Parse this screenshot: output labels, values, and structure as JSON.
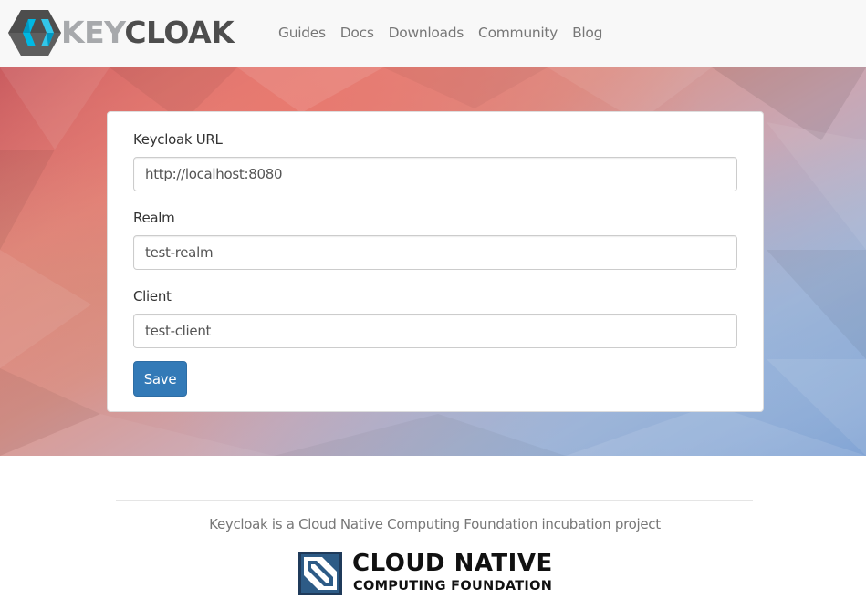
{
  "brand": {
    "logo_text_prefix": "KEY",
    "logo_text_suffix": "CLOAK",
    "colors": {
      "logo_dark": "#4d4d4d",
      "logo_light": "#a7a9ac",
      "logo_blue": "#00b8e3"
    }
  },
  "nav": {
    "items": [
      {
        "label": "Guides"
      },
      {
        "label": "Docs"
      },
      {
        "label": "Downloads"
      },
      {
        "label": "Community"
      },
      {
        "label": "Blog"
      }
    ]
  },
  "form": {
    "fields": [
      {
        "label": "Keycloak URL",
        "value": "http://localhost:8080"
      },
      {
        "label": "Realm",
        "value": "test-realm"
      },
      {
        "label": "Client",
        "value": "test-client"
      }
    ],
    "save_label": "Save",
    "colors": {
      "primary": "#337ab7"
    }
  },
  "footer": {
    "text": "Keycloak is a Cloud Native Computing Foundation incubation project",
    "cncf_line1": "CLOUD NATIVE",
    "cncf_line2": "COMPUTING FOUNDATION"
  }
}
